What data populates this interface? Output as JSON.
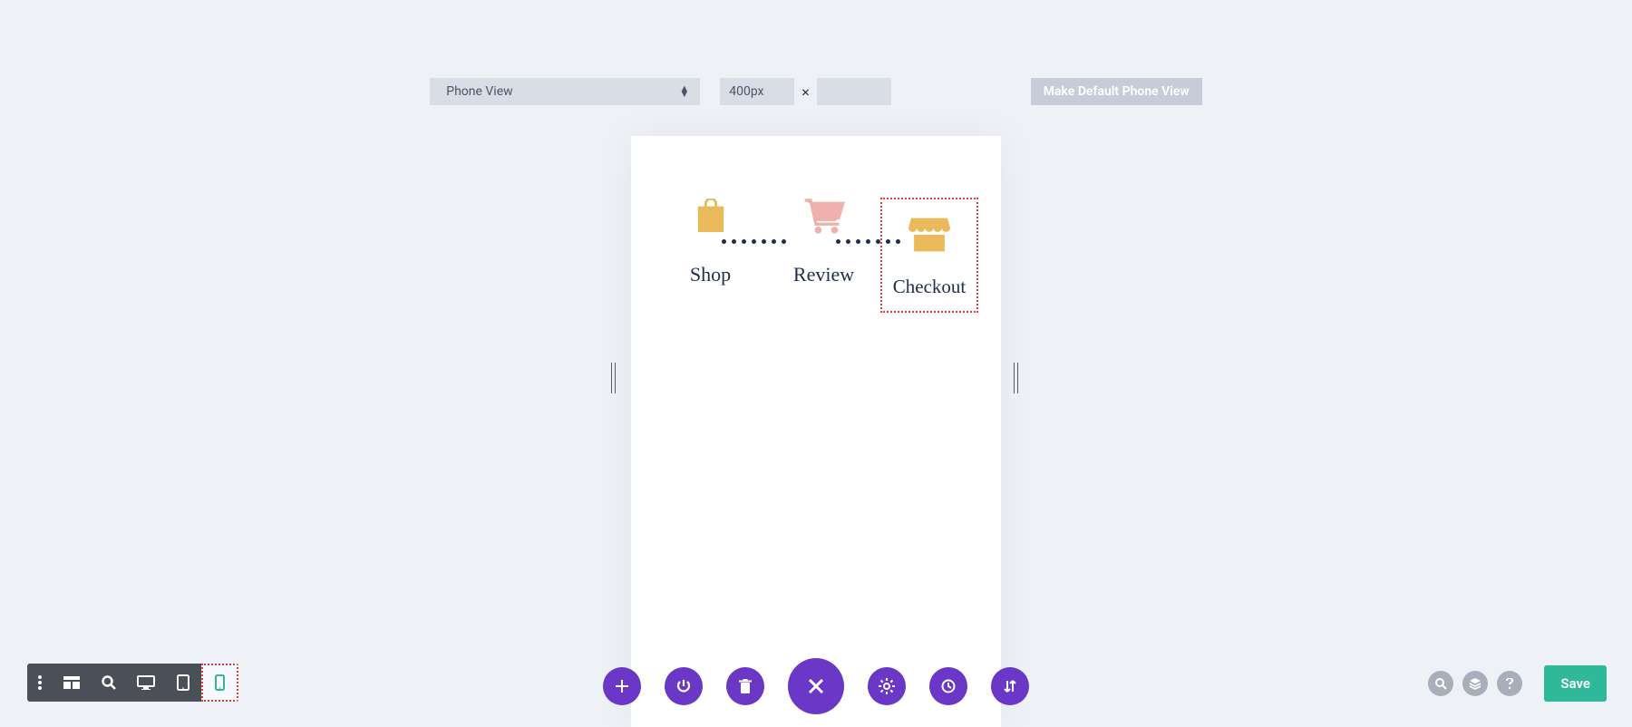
{
  "topbar": {
    "view_select": "Phone View",
    "width_value": "400px",
    "dim_sep": "×",
    "height_value": "",
    "make_default_label": "Make Default Phone View"
  },
  "steps": [
    {
      "label": "Shop",
      "icon": "bag"
    },
    {
      "label": "Review",
      "icon": "cart"
    },
    {
      "label": "Checkout",
      "icon": "store",
      "selected": true
    }
  ],
  "save_label": "Save"
}
